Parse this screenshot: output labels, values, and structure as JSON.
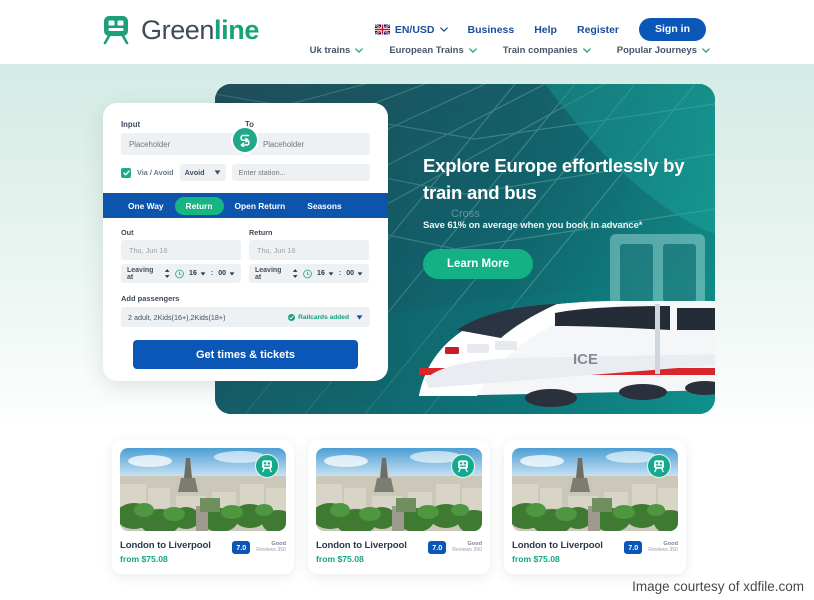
{
  "brand": {
    "name_part1": "Green",
    "name_part2": "line",
    "logo_icon": "tram-icon",
    "accent_green": "#1aa179",
    "accent_blue": "#0b57b8",
    "accent_teal": "#16a98c"
  },
  "header": {
    "language": {
      "label": "EN/USD",
      "flag_icon": "uk-flag-icon",
      "chevron_icon": "chevron-down-icon"
    },
    "links": [
      {
        "label": "Business"
      },
      {
        "label": "Help"
      },
      {
        "label": "Register"
      }
    ],
    "signin_label": "Sign in",
    "nav": [
      {
        "label": "Uk trains",
        "icon": "chevron-down-icon"
      },
      {
        "label": "European Trains",
        "icon": "chevron-down-icon"
      },
      {
        "label": "Train companies",
        "icon": "chevron-down-icon"
      },
      {
        "label": "Popular Journeys",
        "icon": "chevron-down-icon"
      }
    ]
  },
  "hero": {
    "title": "Explore Europe effortlessly by train and bus",
    "subtitle": "Save 61% on average when you book in advance*",
    "cta_label": "Learn More",
    "image_alt": "white-ice-high-speed-train-in-station"
  },
  "booking": {
    "from_label": "Input",
    "to_label": "To",
    "from_placeholder": "Placeholder",
    "to_placeholder": "Placeholder",
    "swap_icon": "swap-arrows-icon",
    "via_checkbox_checked": true,
    "via_check_icon": "check-icon",
    "via_label": "Via / Avoid",
    "via_mode": "Avoid",
    "via_mode_icon": "caret-down-icon",
    "station_placeholder": "Enter station...",
    "tabs": [
      {
        "label": "One Way",
        "active": false
      },
      {
        "label": "Return",
        "active": true
      },
      {
        "label": "Open Return",
        "active": false
      },
      {
        "label": "Seasons",
        "active": false
      }
    ],
    "out": {
      "label": "Out",
      "date": "Thu, Jun 16",
      "time_label": "Leaving at",
      "stepper_icon": "up-down-stepper-icon",
      "clock_icon": "clock-icon",
      "hour": "16",
      "minute": "00",
      "separator": ":"
    },
    "return": {
      "label": "Return",
      "date": "Thu, Jun 16",
      "time_label": "Leaving at",
      "stepper_icon": "up-down-stepper-icon",
      "clock_icon": "clock-icon",
      "hour": "16",
      "minute": "00",
      "separator": ":"
    },
    "passengers_label": "Add passengers",
    "passengers_value": "2 adult, 2Kids(16+),2Kids(18+)",
    "railcards_status": "Railcards added",
    "railcards_icon": "check-circle-icon",
    "passengers_caret": "caret-down-icon",
    "submit_label": "Get times & tickets"
  },
  "route_cards": [
    {
      "title": "London to Liverpool",
      "price": "from $75.08",
      "rating": "7.0",
      "rating_word": "Good",
      "reviews": "Reviews 350",
      "badge_icon": "tram-icon",
      "image_alt": "paris-cityscape-with-eiffel-tower"
    },
    {
      "title": "London to Liverpool",
      "price": "from $75.08",
      "rating": "7.0",
      "rating_word": "Good",
      "reviews": "Reviews 350",
      "badge_icon": "tram-icon",
      "image_alt": "paris-cityscape-with-eiffel-tower"
    },
    {
      "title": "London to Liverpool",
      "price": "from $75.08",
      "rating": "7.0",
      "rating_word": "Good",
      "reviews": "Reviews 350",
      "badge_icon": "tram-icon",
      "image_alt": "paris-cityscape-with-eiffel-tower"
    }
  ],
  "watermark": "Image courtesy of xdfile.com"
}
